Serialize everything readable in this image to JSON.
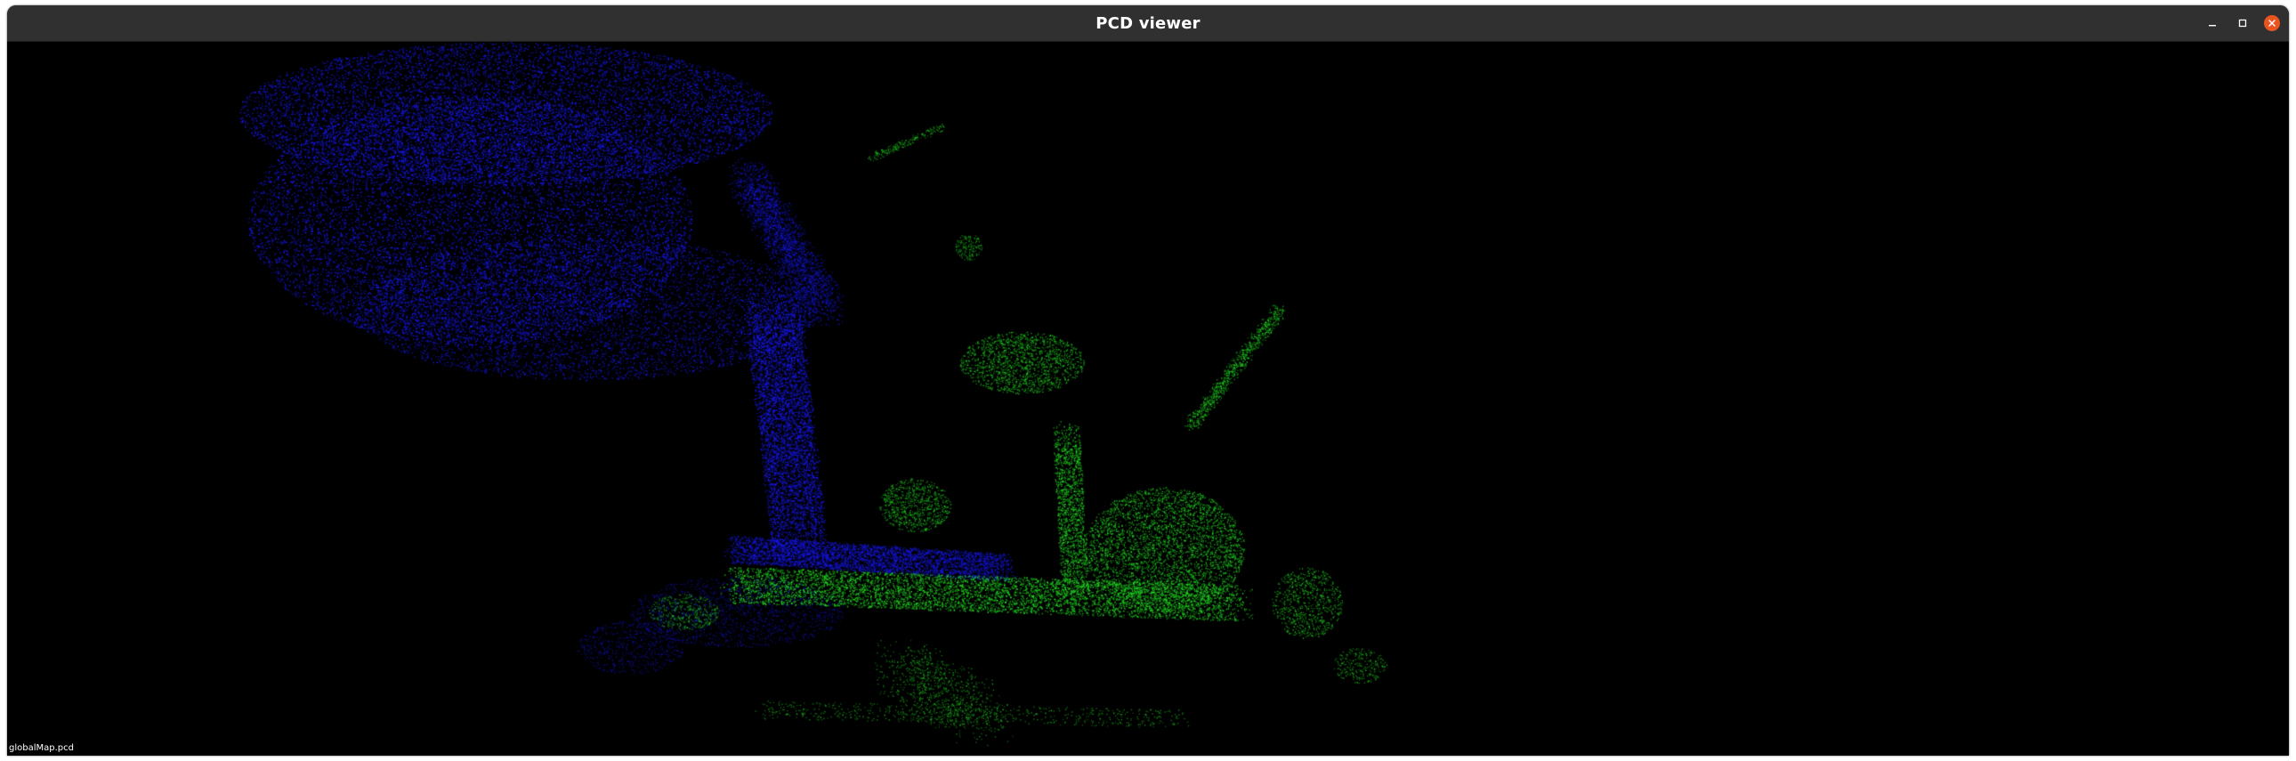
{
  "window": {
    "title": "PCD viewer"
  },
  "viewport": {
    "background": "#000000",
    "status_text": "globalMap.pcd",
    "cloud_colors": {
      "primary": "#1a1aff",
      "secondary": "#22dd22"
    }
  },
  "controls": {
    "minimize_icon": "minimize-icon",
    "maximize_icon": "maximize-icon",
    "close_icon": "close-icon",
    "close_color": "#e95420"
  }
}
